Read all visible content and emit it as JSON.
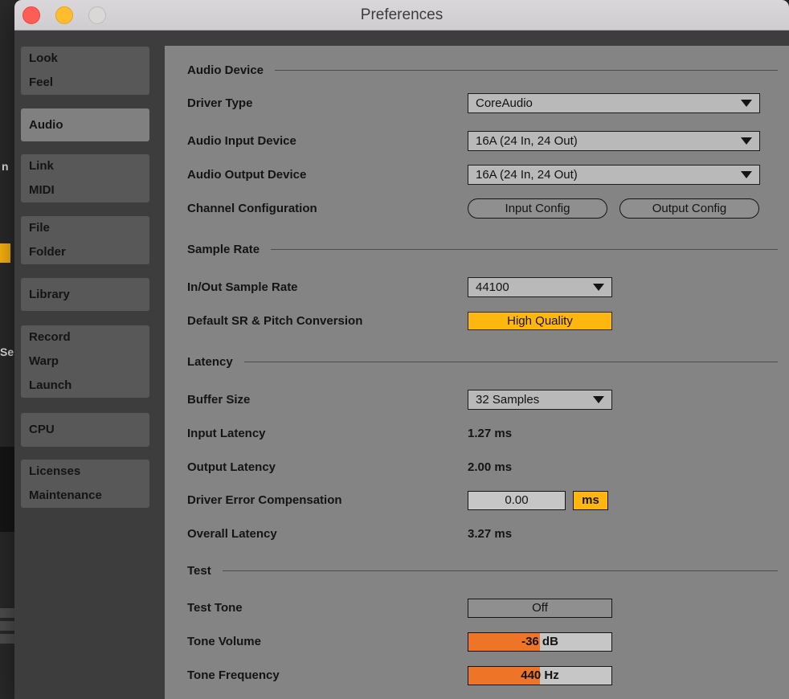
{
  "window": {
    "title": "Preferences"
  },
  "background": {
    "fragments": [
      "n",
      "Se"
    ]
  },
  "sidebar": {
    "tabs": [
      {
        "lines": [
          "Look",
          "Feel"
        ],
        "selected": false
      },
      {
        "lines": [
          "Audio"
        ],
        "selected": true
      },
      {
        "lines": [
          "Link",
          "MIDI"
        ],
        "selected": false
      },
      {
        "lines": [
          "File",
          "Folder"
        ],
        "selected": false
      },
      {
        "lines": [
          "Library"
        ],
        "selected": false
      },
      {
        "lines": [
          "Record",
          "Warp",
          "Launch"
        ],
        "selected": false
      },
      {
        "lines": [
          "CPU"
        ],
        "selected": false
      },
      {
        "lines": [
          "Licenses",
          "Maintenance"
        ],
        "selected": false
      }
    ]
  },
  "audio_device": {
    "title": "Audio Device",
    "driver_type": {
      "label": "Driver Type",
      "value": "CoreAudio"
    },
    "input_device": {
      "label": "Audio Input Device",
      "value": "16A (24 In, 24 Out)"
    },
    "output_device": {
      "label": "Audio Output Device",
      "value": "16A (24 In, 24 Out)"
    },
    "channel_config": {
      "label": "Channel Configuration",
      "input_button": "Input Config",
      "output_button": "Output Config"
    }
  },
  "sample_rate": {
    "title": "Sample Rate",
    "in_out_rate": {
      "label": "In/Out Sample Rate",
      "value": "44100"
    },
    "sr_pitch_conversion": {
      "label": "Default SR & Pitch Conversion",
      "value": "High Quality"
    }
  },
  "latency": {
    "title": "Latency",
    "buffer_size": {
      "label": "Buffer Size",
      "value": "32 Samples"
    },
    "input_latency": {
      "label": "Input Latency",
      "value": "1.27 ms"
    },
    "output_latency": {
      "label": "Output Latency",
      "value": "2.00 ms"
    },
    "driver_error_compensation": {
      "label": "Driver Error Compensation",
      "value": "0.00",
      "unit": "ms"
    },
    "overall_latency": {
      "label": "Overall Latency",
      "value": "3.27 ms"
    }
  },
  "test": {
    "title": "Test",
    "test_tone": {
      "label": "Test Tone",
      "value": "Off"
    },
    "tone_volume": {
      "label": "Tone Volume",
      "value": "-36 dB",
      "fill_percent": 50
    },
    "tone_frequency": {
      "label": "Tone Frequency",
      "value": "440 Hz",
      "fill_percent": 50
    }
  },
  "colors": {
    "accent_yellow": "#ffb70f",
    "accent_orange": "#ee7527",
    "panel_gray": "#848484"
  }
}
